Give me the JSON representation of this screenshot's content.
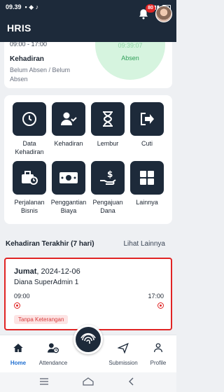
{
  "status_bar": {
    "time": "09.39"
  },
  "header": {
    "title": "HRIS",
    "notification_count": "80"
  },
  "attendance": {
    "hours": "09:00 - 17:00",
    "title": "Kehadiran",
    "status": "Belum Absen / Belum Absen",
    "clock_time": "09:39:07",
    "clock_label": "Absen"
  },
  "menu": [
    {
      "label": "Data Kehadiran",
      "icon": "clock-icon"
    },
    {
      "label": "Kehadiran",
      "icon": "user-check-icon"
    },
    {
      "label": "Lembur",
      "icon": "hourglass-icon"
    },
    {
      "label": "Cuti",
      "icon": "exit-icon"
    },
    {
      "label": "Perjalanan Bisnis",
      "icon": "briefcase-clock-icon"
    },
    {
      "label": "Penggantian Biaya",
      "icon": "money-icon"
    },
    {
      "label": "Pengajuan Dana",
      "icon": "hand-money-icon"
    },
    {
      "label": "Lainnya",
      "icon": "grid-icon"
    }
  ],
  "recent": {
    "title": "Kehadiran Terakhir (7 hari)",
    "link": "Lihat Lainnya",
    "day": "Jumat",
    "date": ", 2024-12-06",
    "name": "Diana SuperAdmin 1",
    "in_time": "09:00",
    "out_time": "17:00",
    "tag": "Tanpa Keterangan"
  },
  "bottom_nav": {
    "home": "Home",
    "attendance": "Attendance",
    "submission": "Submission",
    "profile": "Profile"
  },
  "colors": {
    "primary": "#1d2a3a",
    "accent": "#1f6fd1",
    "alert": "#e02424"
  }
}
